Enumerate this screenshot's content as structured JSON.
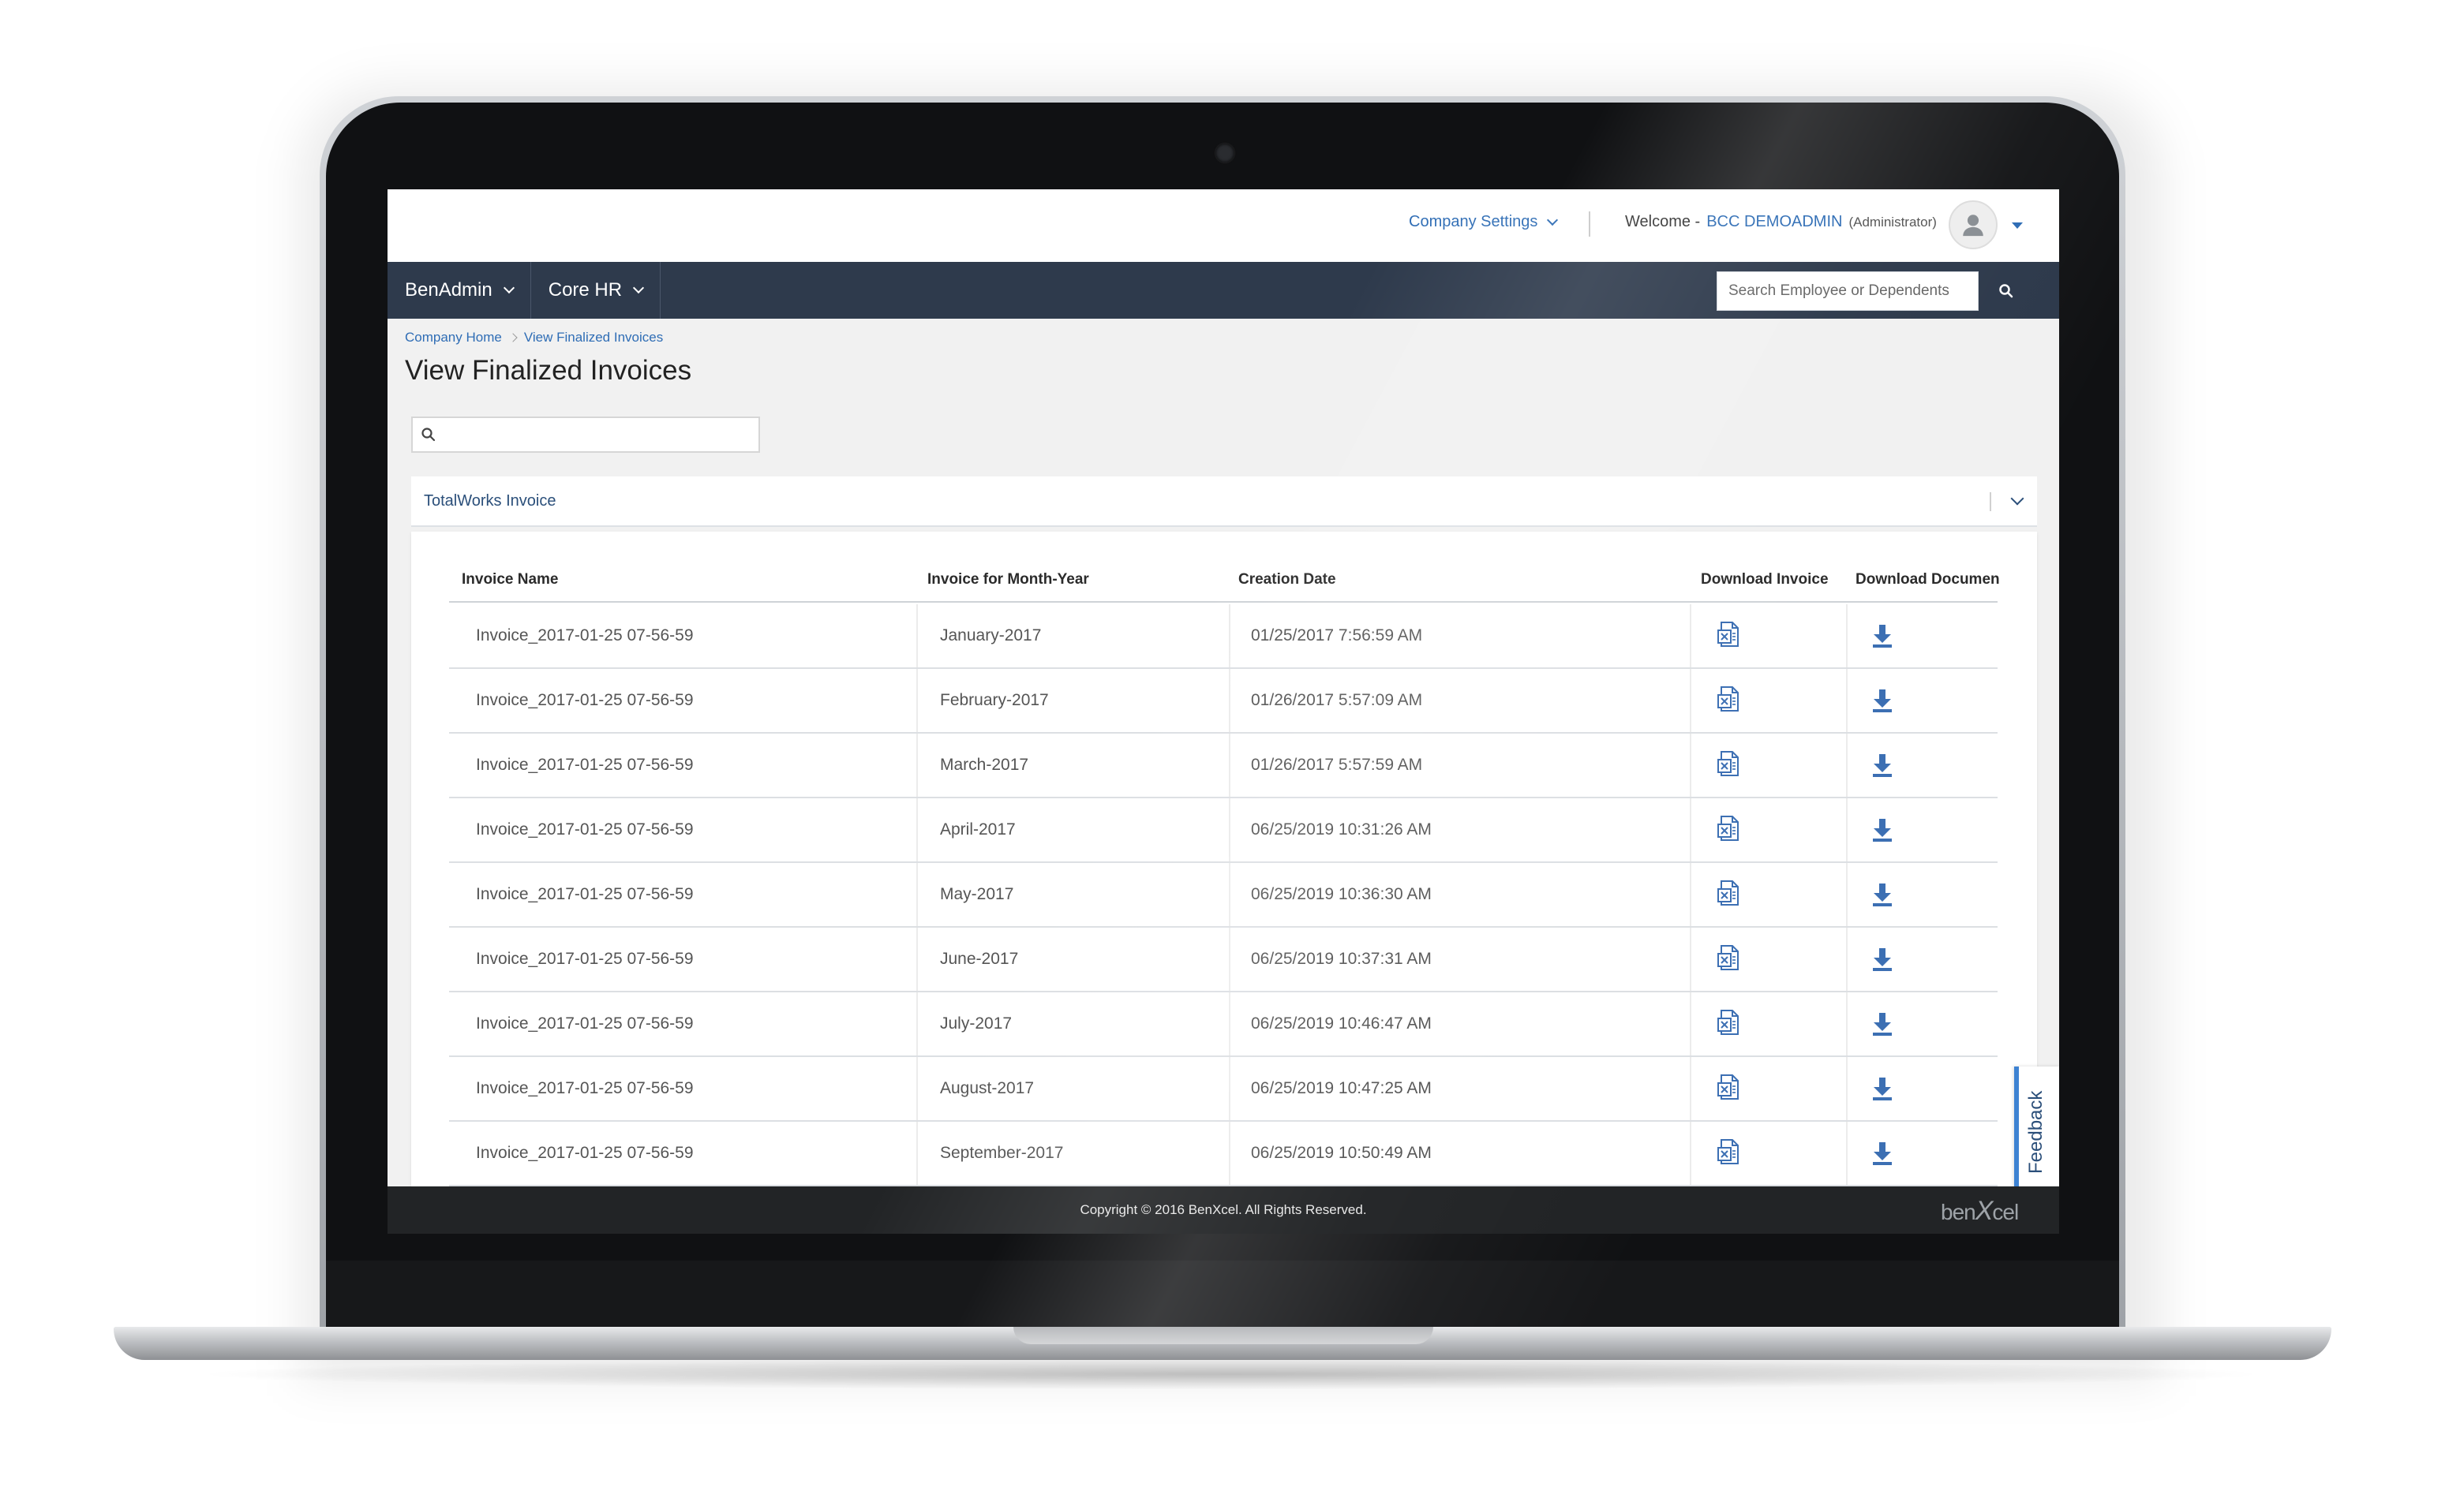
{
  "header": {
    "company_settings": "Company Settings",
    "welcome_label": "Welcome -",
    "user_name": "BCC DEMOADMIN",
    "user_role": "(Administrator)"
  },
  "nav": {
    "items": [
      {
        "label": "BenAdmin"
      },
      {
        "label": "Core HR"
      }
    ],
    "search_placeholder": "Search Employee or Dependents"
  },
  "breadcrumb": {
    "home": "Company Home",
    "current": "View Finalized Invoices"
  },
  "page": {
    "title": "View Finalized Invoices",
    "filter_value": ""
  },
  "card": {
    "title": "TotalWorks Invoice"
  },
  "table": {
    "headers": [
      "Invoice Name",
      "Invoice for Month-Year",
      "Creation Date",
      "Download Invoice",
      "Download Documen"
    ],
    "rows": [
      {
        "name": "Invoice_2017-01-25 07-56-59",
        "month": "January-2017",
        "created": "01/25/2017 7:56:59 AM"
      },
      {
        "name": "Invoice_2017-01-25 07-56-59",
        "month": "February-2017",
        "created": "01/26/2017 5:57:09 AM"
      },
      {
        "name": "Invoice_2017-01-25 07-56-59",
        "month": "March-2017",
        "created": "01/26/2017 5:57:59 AM"
      },
      {
        "name": "Invoice_2017-01-25 07-56-59",
        "month": "April-2017",
        "created": "06/25/2019 10:31:26 AM"
      },
      {
        "name": "Invoice_2017-01-25 07-56-59",
        "month": "May-2017",
        "created": "06/25/2019 10:36:30 AM"
      },
      {
        "name": "Invoice_2017-01-25 07-56-59",
        "month": "June-2017",
        "created": "06/25/2019 10:37:31 AM"
      },
      {
        "name": "Invoice_2017-01-25 07-56-59",
        "month": "July-2017",
        "created": "06/25/2019 10:46:47 AM"
      },
      {
        "name": "Invoice_2017-01-25 07-56-59",
        "month": "August-2017",
        "created": "06/25/2019 10:47:25 AM"
      },
      {
        "name": "Invoice_2017-01-25 07-56-59",
        "month": "September-2017",
        "created": "06/25/2019 10:50:49 AM"
      }
    ]
  },
  "feedback": {
    "label": "Feedback"
  },
  "footer": {
    "copyright": "Copyright © 2016 BenXcel. All Rights Reserved.",
    "brand_prefix": "ben",
    "brand_x": "X",
    "brand_suffix": "cel"
  },
  "icons": {
    "download_invoice": "excel-file-icon",
    "download_document": "download-arrow-icon",
    "search": "search-icon",
    "avatar": "user-avatar-icon"
  },
  "colors": {
    "link": "#2f6db5",
    "navbar": "#2e3a4c",
    "accent": "#3d82d2",
    "footer": "#222426"
  }
}
